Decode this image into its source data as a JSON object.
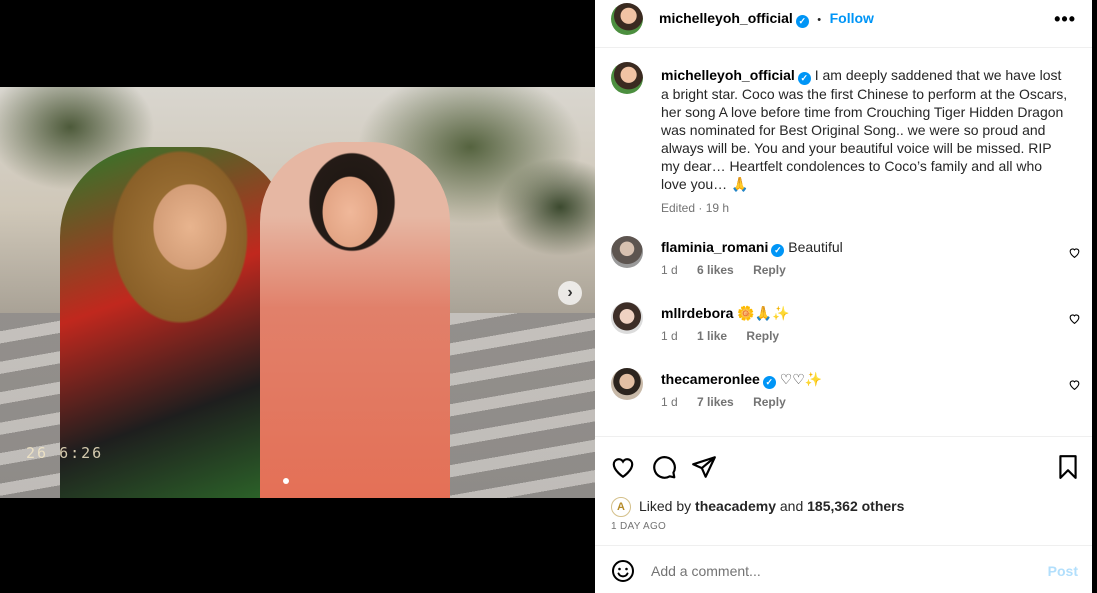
{
  "post": {
    "author": "michelleyoh_official",
    "follow_label": "Follow",
    "separator": "•",
    "more_label": "•••",
    "photo_timestamp": "26  6:26"
  },
  "caption": {
    "author": "michelleyoh_official",
    "text": "I am deeply saddened that we have lost a bright star. Coco was the first Chinese to perform at the Oscars, her song A love before time from Crouching Tiger Hidden Dragon was nominated for Best Original Song.. we were so proud and always will be. You and your beautiful voice will be missed. RIP my dear… Heartfelt condolences to Coco’s family and all who love you… 🙏",
    "meta": "Edited · 19 h"
  },
  "comments": [
    {
      "user": "flaminia_romani",
      "verified": true,
      "text": "Beautiful",
      "age": "1 d",
      "likes": "6 likes",
      "reply": "Reply"
    },
    {
      "user": "mllrdebora",
      "verified": false,
      "text": "🌼🙏✨",
      "age": "1 d",
      "likes": "1 like",
      "reply": "Reply"
    },
    {
      "user": "thecameronlee",
      "verified": true,
      "text": "♡♡✨",
      "age": "1 d",
      "likes": "7 likes",
      "reply": "Reply"
    }
  ],
  "likes": {
    "prefix": "Liked by",
    "user": "theacademy",
    "connector": "and",
    "others": "185,362 others",
    "academy_logo": "A"
  },
  "date": "1 DAY AGO",
  "add_comment": {
    "placeholder": "Add a comment...",
    "post_label": "Post"
  },
  "colors": {
    "accent": "#0095f6",
    "post_disabled": "#b2dffc",
    "muted": "#737373"
  },
  "icons": {
    "next": "chevron-right-icon",
    "like": "heart-icon",
    "comment": "comment-bubble-icon",
    "share": "paper-plane-icon",
    "save": "bookmark-icon",
    "emoji": "smiley-icon",
    "verified": "verified-badge-icon"
  }
}
